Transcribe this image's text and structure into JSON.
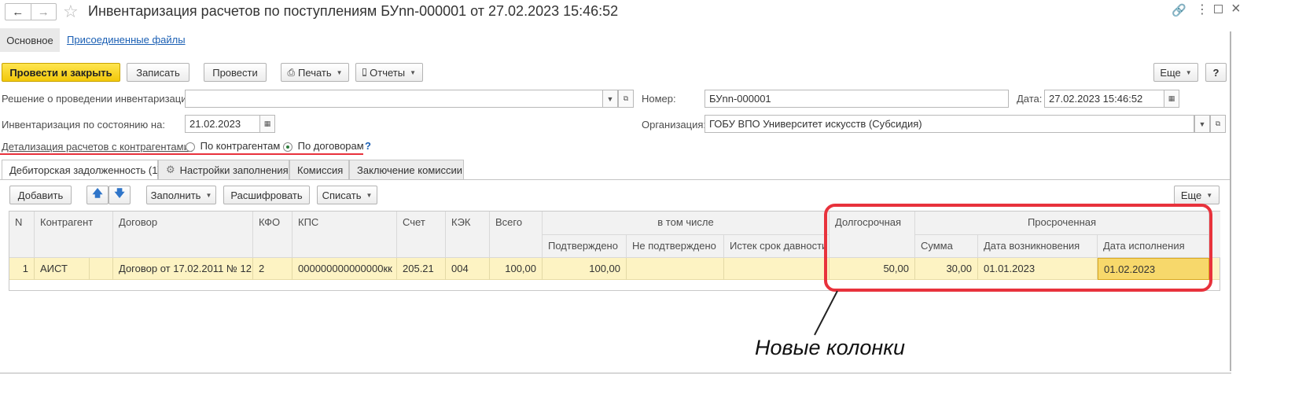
{
  "window": {
    "title": "Инвентаризация расчетов по поступлениям БУnn-000001 от 27.02.2023 15:46:52",
    "nav_tabs": [
      "Основное",
      "Присоединенные файлы"
    ]
  },
  "toolbar": {
    "post_close": "Провести и закрыть",
    "save": "Записать",
    "post": "Провести",
    "print": "Печать",
    "reports": "Отчеты",
    "more": "Еще",
    "help": "?"
  },
  "form": {
    "decision_label": "Решение о проведении инвентаризации:",
    "decision_value": "",
    "number_label": "Номер:",
    "number_value": "БУnn-000001",
    "date_label": "Дата:",
    "date_value": "27.02.2023 15:46:52",
    "state_label": "Инвентаризация по состоянию на:",
    "state_value": "21.02.2023",
    "org_label": "Организация:",
    "org_value": "ГОБУ ВПО Университет искусств (Субсидия)",
    "detail_label": "Детализация расчетов с контрагентами:",
    "detail_options": [
      "По контрагентам",
      "По договорам"
    ],
    "detail_selected": "По договорам",
    "help_mark": "?"
  },
  "tabs": [
    "Дебиторская задолженность (1)",
    "Настройки заполнения",
    "Комиссия",
    "Заключение комиссии"
  ],
  "table_toolbar": {
    "add": "Добавить",
    "fill": "Заполнить",
    "decode": "Расшифровать",
    "writeoff": "Списать",
    "more": "Еще"
  },
  "table": {
    "headers": {
      "n": "N",
      "counterparty": "Контрагент",
      "contract": "Договор",
      "kfo": "КФО",
      "kps": "КПС",
      "account": "Счет",
      "kek": "КЭК",
      "total": "Всего",
      "including": "в том числе",
      "confirmed": "Подтверждено",
      "not_confirmed": "Не подтверждено",
      "expired": "Истек срок давности",
      "long_term": "Долгосрочная",
      "overdue": "Просроченная",
      "sum": "Сумма",
      "occurrence_date": "Дата возникновения",
      "execution_date": "Дата исполнения"
    },
    "rows": [
      {
        "n": "1",
        "counterparty": "АИСТ",
        "contract": "Договор от 17.02.2011 № 12",
        "kfo": "2",
        "kps": "000000000000000кк",
        "account": "205.21",
        "kek": "004",
        "total": "100,00",
        "confirmed": "100,00",
        "not_confirmed": "",
        "expired": "",
        "long_term": "50,00",
        "sum": "30,00",
        "occurrence_date": "01.01.2023",
        "execution_date": "01.02.2023"
      }
    ]
  },
  "annotation": {
    "text": "Новые колонки",
    "color": "#e8323c"
  },
  "colors": {
    "primary_button": "#f5cf14",
    "row_highlight": "#fdf3c3",
    "selected_cell": "#f7d86b",
    "link": "#1a5fb4"
  }
}
